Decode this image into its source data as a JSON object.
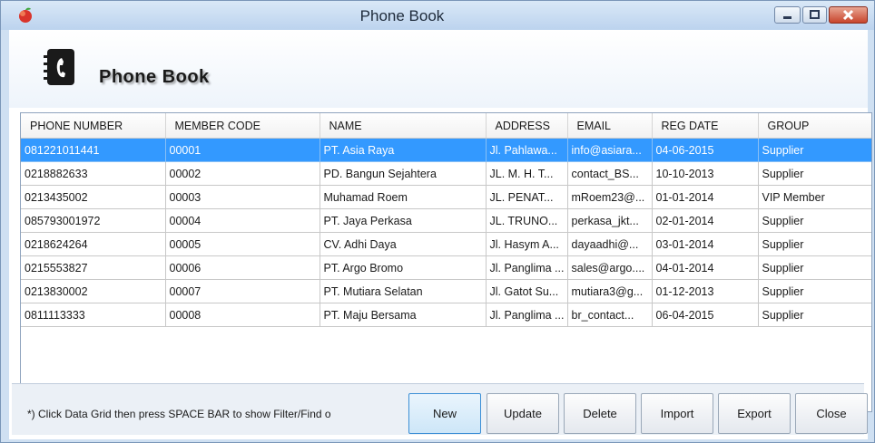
{
  "window": {
    "title": "Phone Book"
  },
  "header": {
    "logo_text": "Phone Book"
  },
  "grid": {
    "columns": [
      "PHONE NUMBER",
      "MEMBER CODE",
      "NAME",
      "ADDRESS",
      "EMAIL",
      "REG DATE",
      "GROUP"
    ],
    "rows": [
      [
        "081221011441",
        "00001",
        "PT. Asia Raya",
        "Jl. Pahlawa...",
        "info@asiara...",
        "04-06-2015",
        "Supplier"
      ],
      [
        "0218882633",
        "00002",
        "PD. Bangun Sejahtera",
        "JL. M. H. T...",
        "contact_BS...",
        "10-10-2013",
        "Supplier"
      ],
      [
        "0213435002",
        "00003",
        "Muhamad Roem",
        "JL. PENAT...",
        "mRoem23@...",
        "01-01-2014",
        "VIP Member"
      ],
      [
        "085793001972",
        "00004",
        "PT. Jaya Perkasa",
        "JL. TRUNO...",
        "perkasa_jkt...",
        "02-01-2014",
        "Supplier"
      ],
      [
        "0218624264",
        "00005",
        "CV. Adhi Daya",
        "Jl. Hasym A...",
        "dayaadhi@...",
        "03-01-2014",
        "Supplier"
      ],
      [
        "0215553827",
        "00006",
        "PT. Argo Bromo",
        "Jl. Panglima ...",
        "sales@argo....",
        "04-01-2014",
        "Supplier"
      ],
      [
        "0213830002",
        "00007",
        "PT. Mutiara Selatan",
        "Jl. Gatot Su...",
        "mutiara3@g...",
        "01-12-2013",
        "Supplier"
      ],
      [
        "0811113333",
        "00008",
        "PT. Maju Bersama",
        "Jl. Panglima ...",
        "br_contact...",
        "06-04-2015",
        "Supplier"
      ]
    ]
  },
  "footer": {
    "hint": "*) Click Data Grid then  press SPACE BAR to show Filter/Find o",
    "buttons": {
      "new": "New",
      "update": "Update",
      "delete": "Delete",
      "import": "Import",
      "export": "Export",
      "close": "Close"
    }
  },
  "colors": {
    "selection": "#3399ff",
    "title_bar": "#c8dbf1",
    "close_button": "#c8452c"
  }
}
